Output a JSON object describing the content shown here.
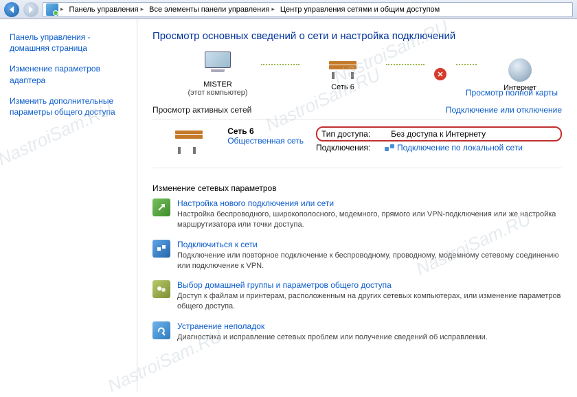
{
  "breadcrumb": {
    "lv1": "Панель управления",
    "lv2": "Все элементы панели управления",
    "lv3": "Центр управления сетями и общим доступом"
  },
  "sidebar": {
    "items": [
      "Панель управления - домашняя страница",
      "Изменение параметров адаптера",
      "Изменить дополнительные параметры общего доступа"
    ]
  },
  "main": {
    "heading": "Просмотр основных сведений о сети и настройка подключений",
    "full_map_link": "Просмотр полной карты",
    "nodes": {
      "computer_name": "MISTER",
      "computer_sub": "(этот компьютер)",
      "network_name": "Сеть 6",
      "internet": "Интернет"
    },
    "active_section": {
      "title": "Просмотр активных сетей",
      "connect_link": "Подключение или отключение",
      "network": {
        "name": "Сеть 6",
        "type": "Общественная сеть"
      },
      "access_label": "Тип доступа:",
      "access_value": "Без доступа к Интернету",
      "conn_label": "Подключения:",
      "conn_value": "Подключение по локальной сети"
    },
    "tasks_title": "Изменение сетевых параметров",
    "tasks": [
      {
        "title": "Настройка нового подключения или сети",
        "desc": "Настройка беспроводного, широкополосного, модемного, прямого или VPN-подключения или же настройка маршрутизатора или точки доступа."
      },
      {
        "title": "Подключиться к сети",
        "desc": "Подключение или повторное подключение к беспроводному, проводному, модемному сетевому соединению или подключение к VPN."
      },
      {
        "title": "Выбор домашней группы и параметров общего доступа",
        "desc": "Доступ к файлам и принтерам, расположенным на других сетевых компьютерах, или изменение параметров общего доступа."
      },
      {
        "title": "Устранение неполадок",
        "desc": "Диагностика и исправление сетевых проблем или получение сведений об исправлении."
      }
    ]
  },
  "watermark": "NastroiSam.RU"
}
